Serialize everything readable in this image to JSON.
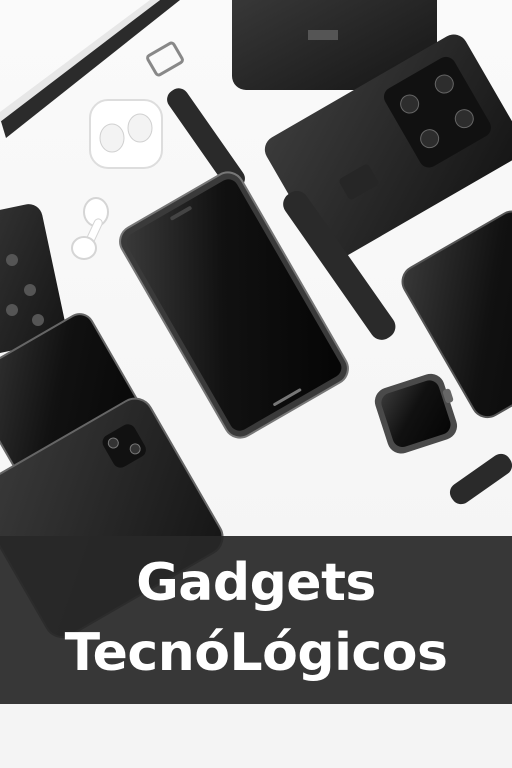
{
  "banner": {
    "line1": "Gadgets",
    "line2": "TecnóLógicos"
  },
  "colors": {
    "banner_bg": "#2a2a2a",
    "text": "#ffffff",
    "device_dark": "#1c1c1c",
    "background": "#f5f5f5"
  }
}
